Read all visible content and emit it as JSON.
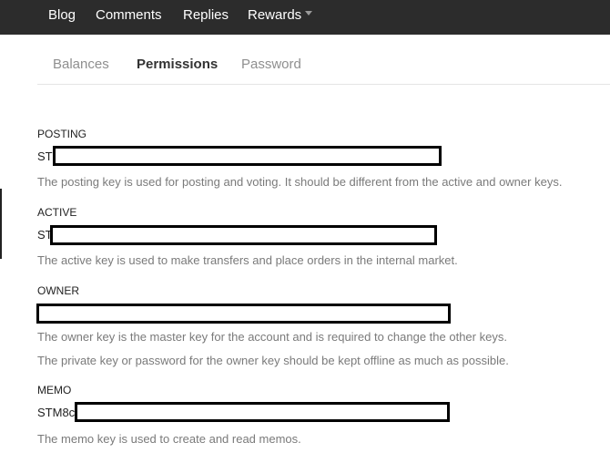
{
  "topnav": {
    "items": [
      {
        "label": "Blog"
      },
      {
        "label": "Comments"
      },
      {
        "label": "Replies"
      },
      {
        "label": "Rewards"
      }
    ]
  },
  "tabs": [
    {
      "label": "Balances",
      "active": false
    },
    {
      "label": "Permissions",
      "active": true
    },
    {
      "label": "Password",
      "active": false
    }
  ],
  "sections": {
    "posting": {
      "label": "POSTING",
      "prefix": "ST",
      "desc": "The posting key is used for posting and voting. It should be different from the active and owner keys."
    },
    "active": {
      "label": "ACTIVE",
      "prefix": "ST",
      "desc": "The active key is used to make transfers and place orders in the internal market."
    },
    "owner": {
      "label": "OWNER",
      "prefix": "",
      "desc": "The owner key is the master key for the account and is required to change the other keys.",
      "desc2": "The private key or password for the owner key should be kept offline as much as possible."
    },
    "memo": {
      "label": "MEMO",
      "prefix": "STM8c",
      "desc": "The memo key is used to create and read memos."
    }
  }
}
